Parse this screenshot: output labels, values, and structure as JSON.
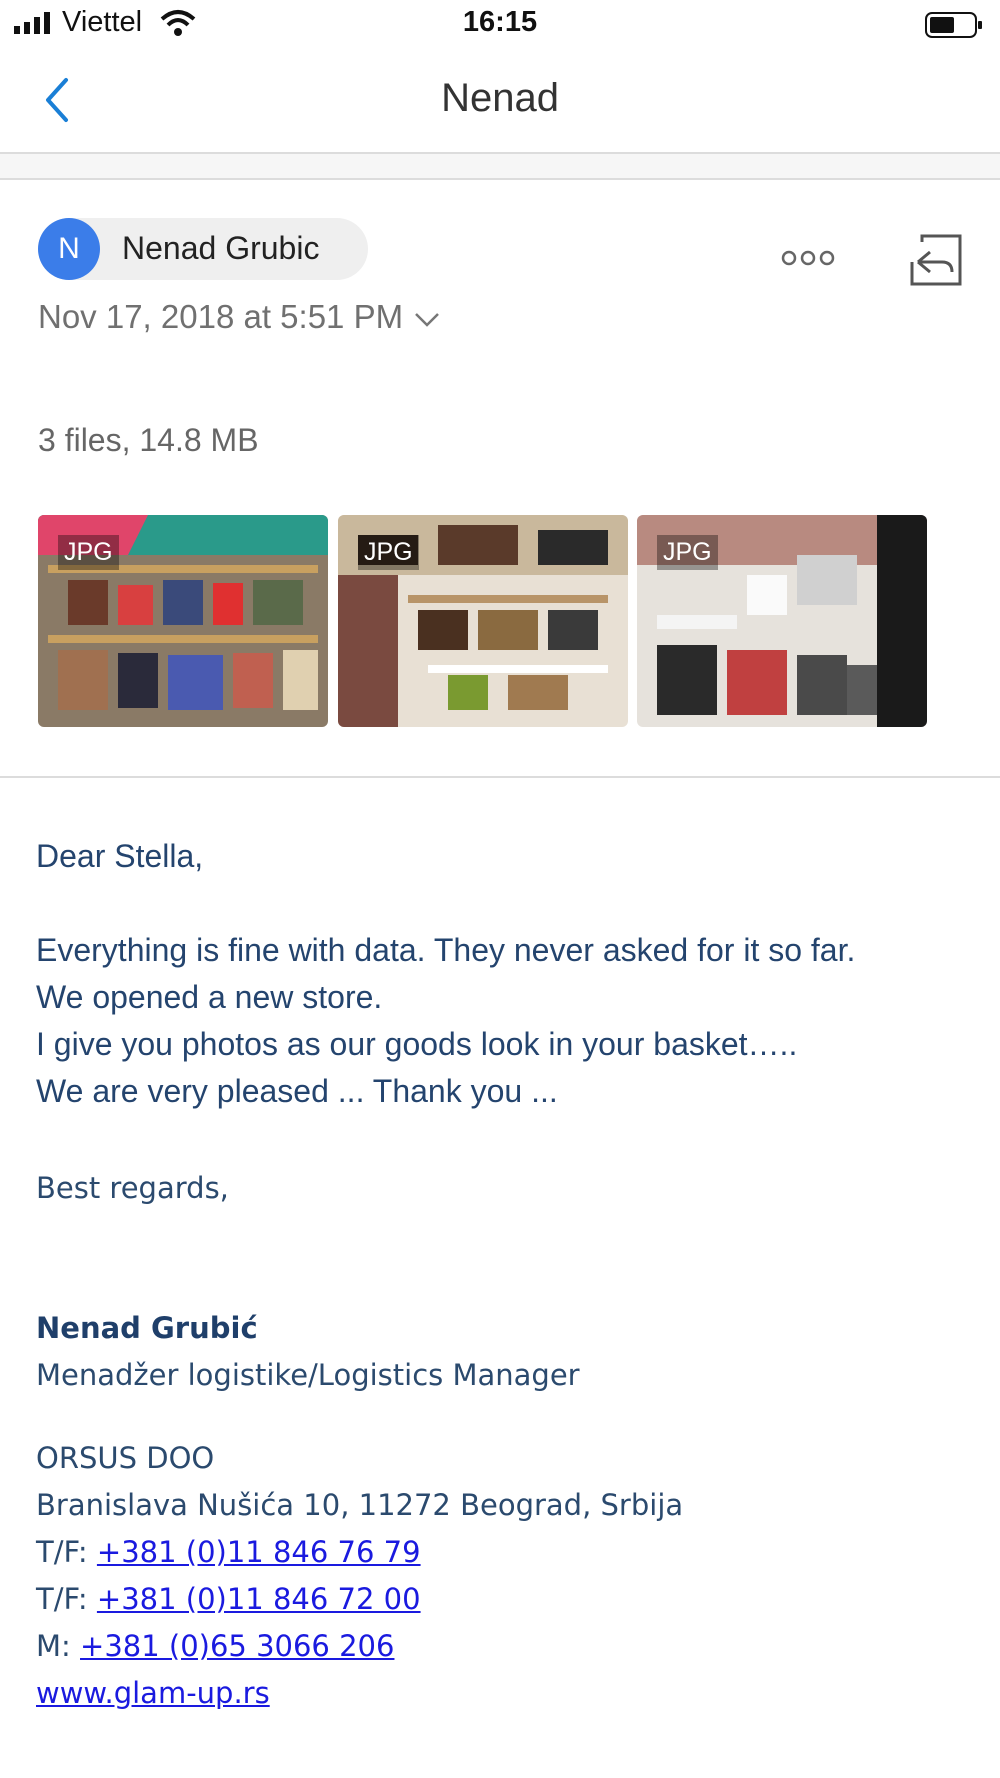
{
  "status_bar": {
    "carrier": "Viettel",
    "time": "16:15",
    "icons": [
      "signal-icon",
      "wifi-icon",
      "battery-icon"
    ]
  },
  "nav": {
    "title": "Nenad",
    "back_icon": "chevron-left-icon"
  },
  "sender": {
    "avatar_initial": "N",
    "name": "Nenad Grubic",
    "date": "Nov 17, 2018 at 5:51 PM",
    "icons": [
      "more-icon",
      "reply-icon",
      "chevron-down-icon"
    ]
  },
  "attachments": {
    "summary": "3 files, 14.8 MB",
    "items": [
      {
        "type": "JPG"
      },
      {
        "type": "JPG"
      },
      {
        "type": "JPG"
      }
    ]
  },
  "message": {
    "greeting": "Dear Stella,",
    "lines": [
      "Everything is fine with data. They never asked for it so far.",
      "We opened a new store.",
      "I give you photos as our goods look in your basket…..",
      "We are very pleased ... Thank you ..."
    ],
    "closing": "Best regards,"
  },
  "signature": {
    "name": "Nenad Grubić",
    "role": "Menadžer logistike/Logistics Manager",
    "company": "ORSUS DOO",
    "address": "Branislava Nušića 10, 11272 Beograd, Srbija",
    "phones": [
      {
        "label": "T/F: ",
        "number": "+381 (0)11 846 76 79"
      },
      {
        "label": "T/F: ",
        "number": "+381 (0)11 846 72 00"
      },
      {
        "label": "M: ",
        "number": "+381 (0)65 3066 206"
      }
    ],
    "website": "www.glam-up.rs"
  },
  "colors": {
    "accent": "#3b7de9",
    "back_chevron": "#1a7fd6",
    "body_text": "#24446e",
    "link": "#1a1adf"
  }
}
